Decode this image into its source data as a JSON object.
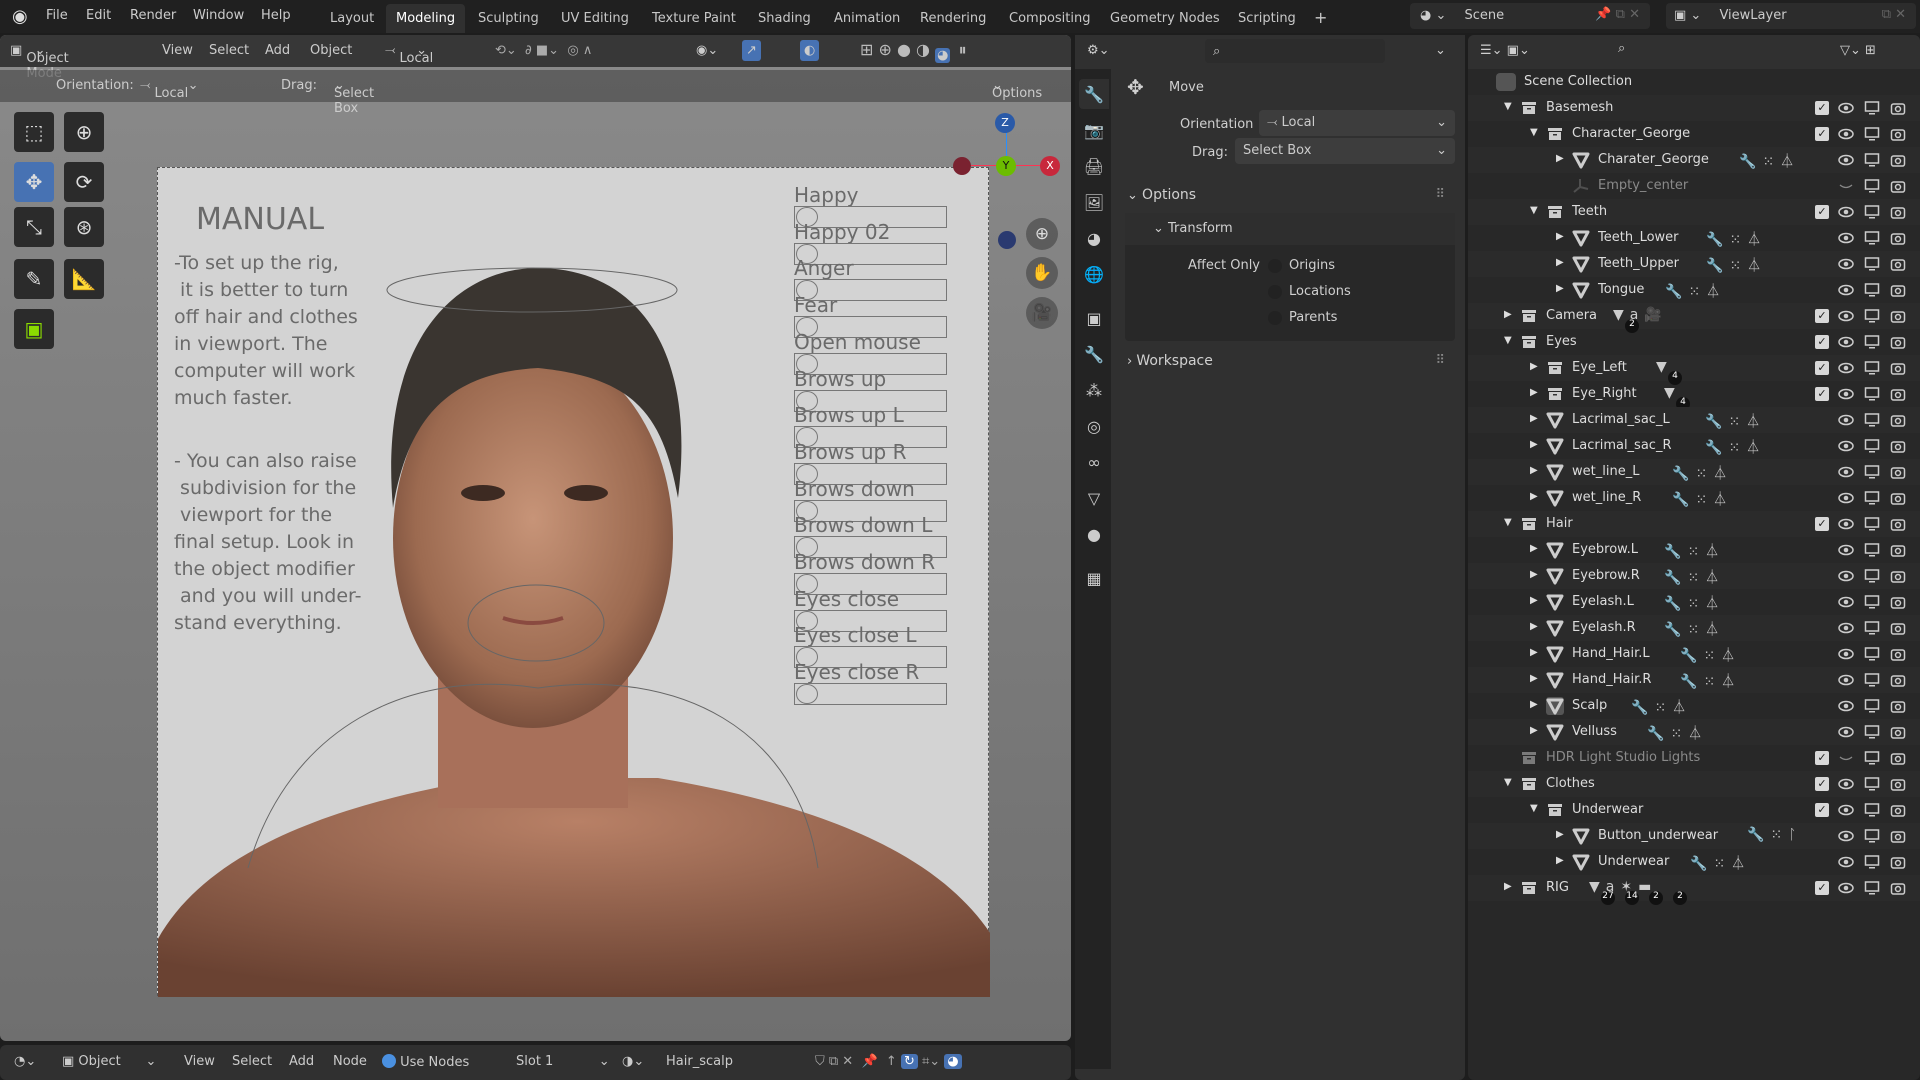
{
  "topbar": {
    "menus": [
      "File",
      "Edit",
      "Render",
      "Window",
      "Help"
    ],
    "workspaces": [
      "Layout",
      "Modeling",
      "Sculpting",
      "UV Editing",
      "Texture Paint",
      "Shading",
      "Animation",
      "Rendering",
      "Compositing",
      "Geometry Nodes",
      "Scripting"
    ],
    "active_workspace": "Modeling",
    "add_workspace": "+",
    "scene": "Scene",
    "view_layer": "ViewLayer"
  },
  "viewport": {
    "mode": "Object Mode",
    "menus": [
      "View",
      "Select",
      "Add",
      "Object"
    ],
    "transform_orientation": "Local",
    "orientation_label": "Orientation:",
    "orientation_value": "Local",
    "drag_label": "Drag:",
    "drag_value": "Select Box",
    "options": "Options",
    "gizmo": {
      "x": "X",
      "y": "Y",
      "z": "Z"
    },
    "manual": {
      "title": "MANUAL",
      "para1": "-To set up the rig,\n it is better to turn\noff hair and clothes\nin viewport. The\ncomputer will work\nmuch faster.",
      "para2": "- You can also raise\n subdivision for the\n viewport for the\nfinal setup. Look in\nthe object modifier\n and you will under-\nstand everything."
    },
    "shape_keys": [
      "Happy",
      "Happy 02",
      "Anger",
      "Fear",
      "Open mouse",
      "Brows up",
      "Brows up L",
      "Brows up R",
      "Brows down",
      "Brows down L",
      "Brows down R",
      "Eyes close",
      "Eyes close L",
      "Eyes close R"
    ]
  },
  "bottombar": {
    "editor": "Object",
    "menus": [
      "View",
      "Select",
      "Add",
      "Node"
    ],
    "use_nodes": "Use Nodes",
    "slot": "Slot 1",
    "material": "Hair_scalp"
  },
  "properties": {
    "tool_name": "Move",
    "orientation_label": "Orientation",
    "orientation_value": "Local",
    "drag_label": "Drag:",
    "drag_value": "Select Box",
    "options": "Options",
    "transform": "Transform",
    "affect_only": "Affect Only",
    "affect_options": [
      "Origins",
      "Locations",
      "Parents"
    ],
    "workspace": "Workspace"
  },
  "outliner": {
    "root": "Scene Collection",
    "rows": [
      {
        "name": "Basemesh",
        "depth": 0,
        "type": "collection",
        "open": true,
        "check": true
      },
      {
        "name": "Character_George",
        "depth": 1,
        "type": "collection",
        "open": true,
        "check": true
      },
      {
        "name": "Charater_George",
        "depth": 2,
        "type": "mesh",
        "open": false,
        "extras": "wrench particles vgroup"
      },
      {
        "name": "Empty_center",
        "depth": 2,
        "type": "empty",
        "dim": true,
        "hidden": true
      },
      {
        "name": "Teeth",
        "depth": 1,
        "type": "collection",
        "open": true,
        "check": true
      },
      {
        "name": "Teeth_Lower",
        "depth": 2,
        "type": "mesh",
        "open": false,
        "extras": "wrench particles vgroup"
      },
      {
        "name": "Teeth_Upper",
        "depth": 2,
        "type": "mesh",
        "open": false,
        "extras": "wrench particles vgroup"
      },
      {
        "name": "Tongue",
        "depth": 2,
        "type": "mesh",
        "open": false,
        "extras": "wrench particles vgroup"
      },
      {
        "name": "Camera",
        "depth": 0,
        "type": "collection",
        "open": false,
        "check": true,
        "extras": "mesh curve camera",
        "badges": [
          "2"
        ]
      },
      {
        "name": "Eyes",
        "depth": 0,
        "type": "collection",
        "open": true,
        "check": true
      },
      {
        "name": "Eye_Left",
        "depth": 1,
        "type": "collection",
        "open": false,
        "check": true,
        "extras": "mesh",
        "badges": [
          "4"
        ]
      },
      {
        "name": "Eye_Right",
        "depth": 1,
        "type": "collection",
        "open": false,
        "check": true,
        "extras": "mesh",
        "badges": [
          "4"
        ]
      },
      {
        "name": "Lacrimal_sac_L",
        "depth": 1,
        "type": "mesh",
        "open": false,
        "extras": "wrench particles vgroup"
      },
      {
        "name": "Lacrimal_sac_R",
        "depth": 1,
        "type": "mesh",
        "open": false,
        "extras": "wrench particles vgroup"
      },
      {
        "name": "wet_line_L",
        "depth": 1,
        "type": "mesh",
        "open": false,
        "extras": "wrench particles vgroup"
      },
      {
        "name": "wet_line_R",
        "depth": 1,
        "type": "mesh",
        "open": false,
        "extras": "wrench particles vgroup"
      },
      {
        "name": "Hair",
        "depth": 0,
        "type": "collection",
        "open": true,
        "check": true
      },
      {
        "name": "Eyebrow.L",
        "depth": 1,
        "type": "mesh",
        "open": false,
        "extras": "wrench particles vgroup"
      },
      {
        "name": "Eyebrow.R",
        "depth": 1,
        "type": "mesh",
        "open": false,
        "extras": "wrench particles vgroup"
      },
      {
        "name": "Eyelash.L",
        "depth": 1,
        "type": "mesh",
        "open": false,
        "extras": "wrench particles vgroup"
      },
      {
        "name": "Eyelash.R",
        "depth": 1,
        "type": "mesh",
        "open": false,
        "extras": "wrench particles vgroup"
      },
      {
        "name": "Hand_Hair.L",
        "depth": 1,
        "type": "mesh",
        "open": false,
        "extras": "wrench particles vgroup"
      },
      {
        "name": "Hand_Hair.R",
        "depth": 1,
        "type": "mesh",
        "open": false,
        "extras": "wrench particles vgroup"
      },
      {
        "name": "Scalp",
        "depth": 1,
        "type": "mesh",
        "open": false,
        "active": true,
        "extras": "wrench particles vgroup"
      },
      {
        "name": "Velluss",
        "depth": 1,
        "type": "mesh",
        "open": false,
        "extras": "wrench particles vgroup"
      },
      {
        "name": "HDR Light Studio Lights",
        "depth": 0,
        "type": "collection",
        "dim": true,
        "check": true,
        "hidden": true
      },
      {
        "name": "Clothes",
        "depth": 0,
        "type": "collection",
        "open": true,
        "check": true
      },
      {
        "name": "Underwear",
        "depth": 1,
        "type": "collection",
        "open": true,
        "check": true
      },
      {
        "name": "Button_underwear",
        "depth": 2,
        "type": "mesh",
        "open": false,
        "extras": "wrench particles hook"
      },
      {
        "name": "Underwear",
        "depth": 2,
        "type": "mesh",
        "open": false,
        "extras": "wrench particles vgroup"
      },
      {
        "name": "RIG",
        "depth": 0,
        "type": "collection",
        "open": false,
        "check": true,
        "extras": "mesh curve armature collection",
        "badges": [
          "27",
          "14",
          "2",
          "2"
        ]
      }
    ]
  },
  "colors": {
    "accent": "#4772b3",
    "x_axis": "#ff3352",
    "y_axis": "#8bdc00",
    "z_axis": "#2890ff"
  }
}
